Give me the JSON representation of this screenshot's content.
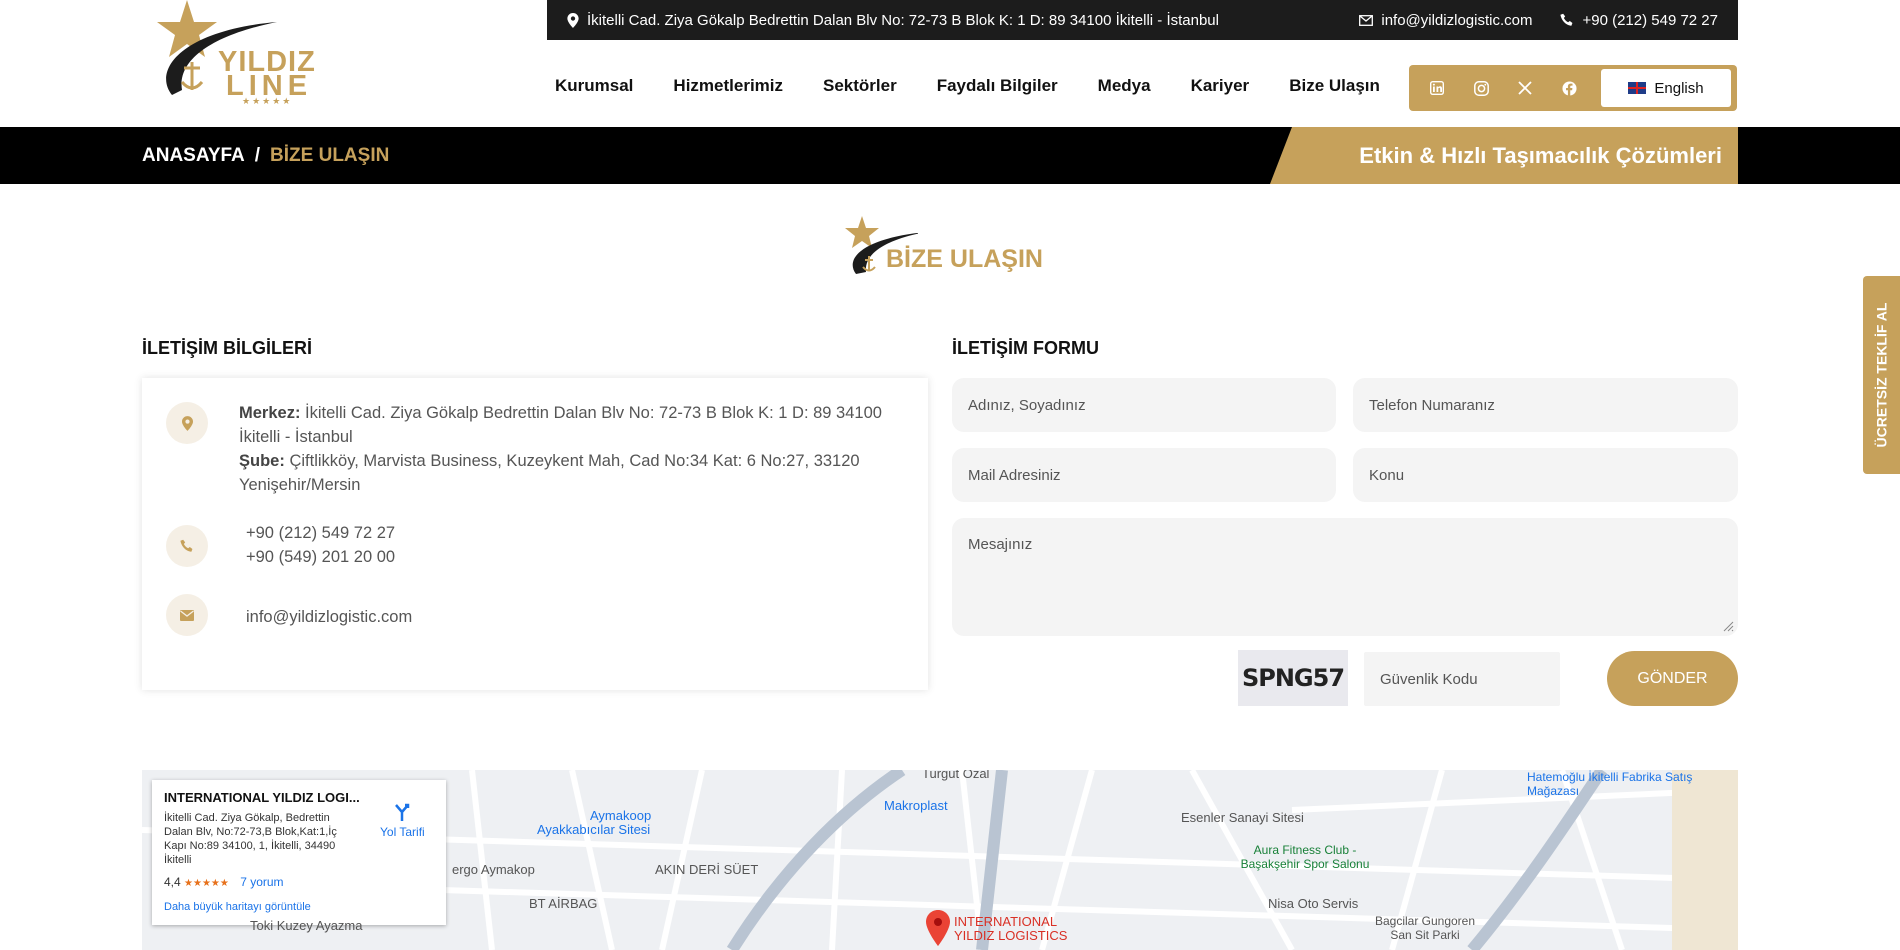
{
  "topbar": {
    "address": "İkitelli Cad. Ziya Gökalp Bedrettin Dalan Blv No: 72-73 B Blok K: 1 D: 89 34100 İkitelli - İstanbul",
    "email": "info@yildizlogistic.com",
    "phone": "+90 (212) 549 72 27"
  },
  "logo": {
    "line1": "YILDIZ",
    "line2": "LINE",
    "stars": "★★★★★"
  },
  "nav": {
    "items": [
      "Kurumsal",
      "Hizmetlerimiz",
      "Sektörler",
      "Faydalı Bilgiler",
      "Medya",
      "Kariyer",
      "Bize Ulaşın"
    ]
  },
  "social": {
    "icons": [
      "linkedin-icon",
      "instagram-icon",
      "x-icon",
      "facebook-icon"
    ],
    "language": "English"
  },
  "breadcrumb": {
    "home": "ANASAYFA",
    "separator": "/",
    "current": "BİZE ULAŞIN"
  },
  "slogan": "Etkin & Hızlı Taşımacılık Çözümleri",
  "section_title": "BİZE ULAŞIN",
  "info": {
    "heading": "İLETİŞİM BİLGİLERİ",
    "hq_label": "Merkez:",
    "hq": "İkitelli Cad. Ziya Gökalp Bedrettin Dalan Blv No: 72-73 B Blok K: 1 D: 89 34100 İkitelli - İstanbul",
    "branch_label": "Şube:",
    "branch": "Çiftlikköy, Marvista Business, Kuzeykent Mah, Cad No:34 Kat: 6 No:27, 33120 Yenişehir/Mersin",
    "phone1": "+90 (212) 549 72 27",
    "phone2": "+90 (549) 201 20 00",
    "email": "info@yildizlogistic.com"
  },
  "form": {
    "heading": "İLETİŞİM FORMU",
    "name_ph": "Adınız, Soyadınız",
    "phone_ph": "Telefon Numaranız",
    "mail_ph": "Mail Adresiniz",
    "subject_ph": "Konu",
    "message_ph": "Mesajınız",
    "captcha": "SPNG57",
    "code_ph": "Güvenlik Kodu",
    "submit": "GÖNDER"
  },
  "side_tab": "ÜCRETSİZ TEKLİF AL",
  "map": {
    "place_name": "INTERNATIONAL YILDIZ LOGI...",
    "place_address": "İkitelli Cad. Ziya Gökalp, Bedrettin Dalan Blv, No:72-73,B Blok,Kat:1,İç Kapı No:89 34100, 1, İkitelli, 34490 İkitelli",
    "rating": "4,4",
    "stars": "★★★★★",
    "reviews": "7 yorum",
    "bigger_map": "Daha büyük haritayı görüntüle",
    "directions": "Yol Tarifi",
    "labels": [
      "Aymakoop",
      "Ayakkabıcılar Sitesi",
      "Makroplast",
      "Esenler Sanayi Sitesi",
      "Hatemoğlu İkitelli Fabrika Satış Mağazası",
      "Aura Fitness Club - Başakşehir Spor Salonu",
      "AKIN DERİ SÜET",
      "BT AİRBAG",
      "Nisa Oto Servis",
      "Bagcilar Gungoren San Sit Parki",
      "INTERNATIONAL YILDIZ LOGISTICS",
      "Turgut Özal",
      "ergo Aymakop",
      "Toki Kuzey Ayazma"
    ]
  },
  "colors": {
    "gold": "#c6a15b",
    "dark": "#1c1c1c"
  }
}
